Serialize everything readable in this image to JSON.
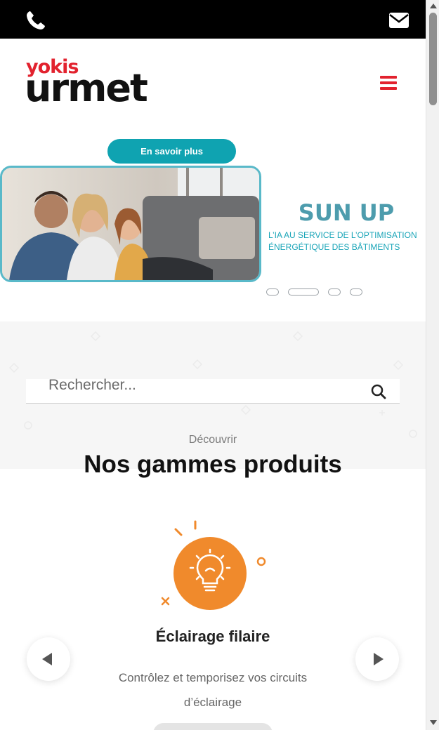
{
  "header": {
    "logo": {
      "top": "yokis",
      "bottom": "urmet"
    },
    "icons": {
      "phone": "phone-icon",
      "mail": "mail-icon",
      "menu": "hamburger-menu-icon"
    }
  },
  "hero": {
    "cta_label": "En savoir plus",
    "slide_title": "SUN UP",
    "slide_text": "L’IA AU SERVICE DE L’OPTIMISATION ÉNERGÉTIQUE DES BÂTIMENTS",
    "slide_count": 4,
    "active_slide": 2
  },
  "search": {
    "placeholder": "Rechercher..."
  },
  "products": {
    "kicker": "Découvrir",
    "title": "Nos gammes produits",
    "card": {
      "icon": "lightbulb-icon",
      "title": "Éclairage filaire",
      "description": "Contrôlez et temporisez vos circuits d’éclairage"
    }
  },
  "colors": {
    "brand_red": "#e2222e",
    "teal": "#0fa3b1",
    "orange": "#f08a2c"
  }
}
